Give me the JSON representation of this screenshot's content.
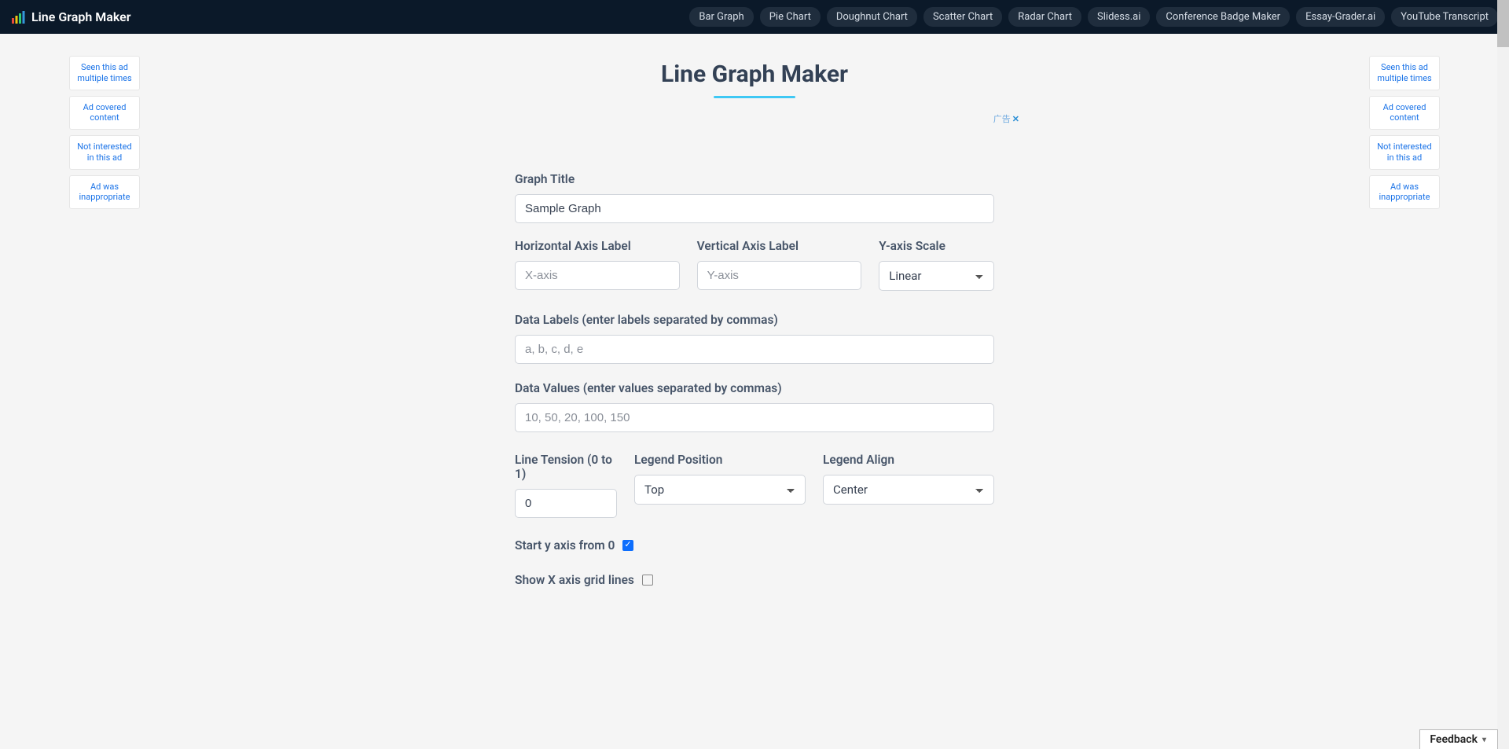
{
  "header": {
    "brand": "Line Graph Maker",
    "nav": [
      "Bar Graph",
      "Pie Chart",
      "Doughnut Chart",
      "Scatter Chart",
      "Radar Chart",
      "Slidess.ai",
      "Conference Badge Maker",
      "Essay-Grader.ai",
      "YouTube Transcript"
    ]
  },
  "ad_feedback": {
    "items": [
      "Seen this ad multiple times",
      "Ad covered content",
      "Not interested in this ad",
      "Ad was inappropriate"
    ]
  },
  "page": {
    "title": "Line Graph Maker",
    "ad_marker": "广告",
    "feedback_button": "Feedback"
  },
  "form": {
    "graph_title": {
      "label": "Graph Title",
      "value": "Sample Graph"
    },
    "h_axis": {
      "label": "Horizontal Axis Label",
      "placeholder": "X-axis",
      "value": ""
    },
    "v_axis": {
      "label": "Vertical Axis Label",
      "placeholder": "Y-axis",
      "value": ""
    },
    "y_scale": {
      "label": "Y-axis Scale",
      "value": "Linear"
    },
    "data_labels": {
      "label": "Data Labels (enter labels separated by commas)",
      "placeholder": "a, b, c, d, e",
      "value": ""
    },
    "data_values": {
      "label": "Data Values (enter values separated by commas)",
      "placeholder": "10, 50, 20, 100, 150",
      "value": ""
    },
    "line_tension": {
      "label": "Line Tension (0 to 1)",
      "value": "0"
    },
    "legend_position": {
      "label": "Legend Position",
      "value": "Top"
    },
    "legend_align": {
      "label": "Legend Align",
      "value": "Center"
    },
    "start_y_zero": {
      "label": "Start y axis from 0",
      "checked": true
    },
    "show_x_grid": {
      "label": "Show X axis grid lines",
      "checked": false
    }
  }
}
